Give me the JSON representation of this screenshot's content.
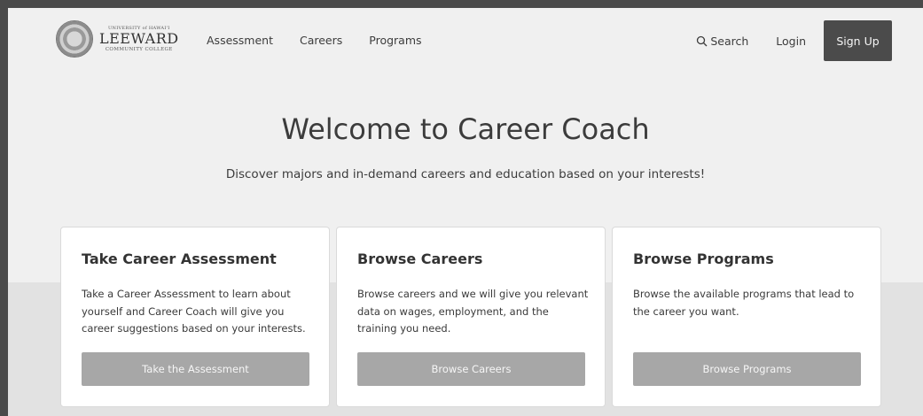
{
  "brand": {
    "small_text": "UNIVERSITY of HAWAI'I",
    "name": "LEEWARD",
    "sub_text": "COMMUNITY COLLEGE"
  },
  "nav": {
    "assessment": "Assessment",
    "careers": "Careers",
    "programs": "Programs",
    "search": "Search",
    "login": "Login",
    "signup": "Sign Up"
  },
  "hero": {
    "title": "Welcome to Career Coach",
    "subtitle": "Discover majors and in-demand careers and education based on your interests!"
  },
  "cards": [
    {
      "title": "Take Career Assessment",
      "description": "Take a Career Assessment to learn about yourself and Career Coach will give you career suggestions based on your interests.",
      "button": "Take the Assessment"
    },
    {
      "title": "Browse Careers",
      "description": "Browse careers and we will give you relevant data on wages, employment, and the training you need.",
      "button": "Browse Careers"
    },
    {
      "title": "Browse Programs",
      "description": "Browse the available programs that lead to the career you want.",
      "button": "Browse Programs"
    }
  ],
  "colors": {
    "primary_button": "#4b4b4b",
    "card_button": "#a7a7a7",
    "page_background": "#f0f0f0"
  },
  "icons": [
    "search-icon",
    "college-seal-logo"
  ]
}
